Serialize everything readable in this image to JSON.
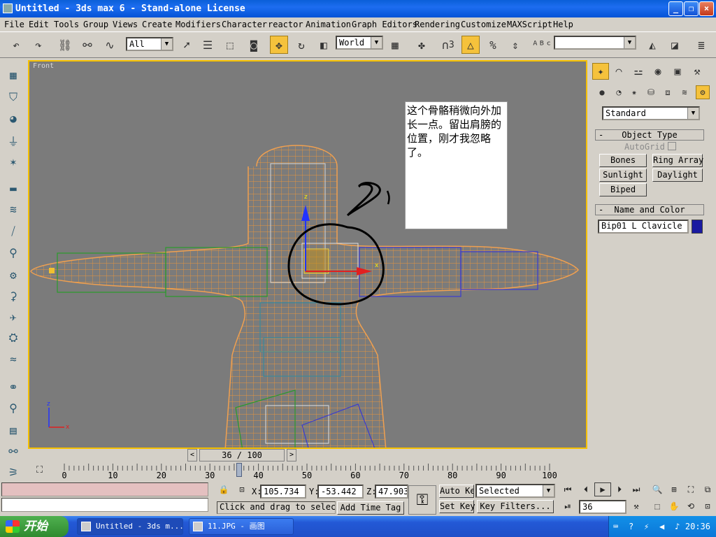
{
  "window": {
    "title": "Untitled - 3ds max 6 - Stand-alone License",
    "btn_min": "_",
    "btn_max": "❐",
    "btn_close": "×"
  },
  "menu": [
    "File",
    "Edit",
    "Tools",
    "Group",
    "Views",
    "Create",
    "Modifiers",
    "Character",
    "reactor",
    "Animation",
    "Graph Editors",
    "Rendering",
    "Customize",
    "MAXScript",
    "Help"
  ],
  "toolbar": {
    "selection_filter": "All",
    "ref_coord": "World",
    "named_selection": "",
    "snap_count": "3"
  },
  "viewport": {
    "label": "Front",
    "note": "这个骨骼稍微向外加长一点。留出肩膀的位置，刚才我忽略了。",
    "axis_z": "z",
    "axis_x": "x"
  },
  "command_panel": {
    "category": "Standard",
    "object_type_title": "Object Type",
    "autogrid": "AutoGrid",
    "buttons": [
      "Bones",
      "Ring Array",
      "Sunlight",
      "Daylight",
      "Biped"
    ],
    "name_color_title": "Name and Color",
    "object_name": "Bip01 L Clavicle",
    "object_color": "#1a1aa0",
    "rollout_minus": "-"
  },
  "timeline": {
    "frame_display": "36 / 100",
    "ticks": [
      "0",
      "10",
      "20",
      "30",
      "40",
      "50",
      "60",
      "70",
      "80",
      "90",
      "100"
    ],
    "prev": "<",
    "next": ">"
  },
  "status": {
    "x_label": "X:",
    "x_value": "105.734",
    "y_label": "Y:",
    "y_value": "-53.442",
    "z_label": "Z:",
    "z_value": "47.903",
    "prompt": "Click and drag to select",
    "add_time_tag": "Add Time Tag",
    "auto_key": "Auto Key",
    "set_key": "Set Key",
    "key_mode": "Selected",
    "key_filters": "Key Filters...",
    "current_frame": "36"
  },
  "taskbar": {
    "start": "开始",
    "tasks": [
      "Untitled - 3ds m...",
      "11.JPG - 画图"
    ],
    "clock": "20:36"
  }
}
